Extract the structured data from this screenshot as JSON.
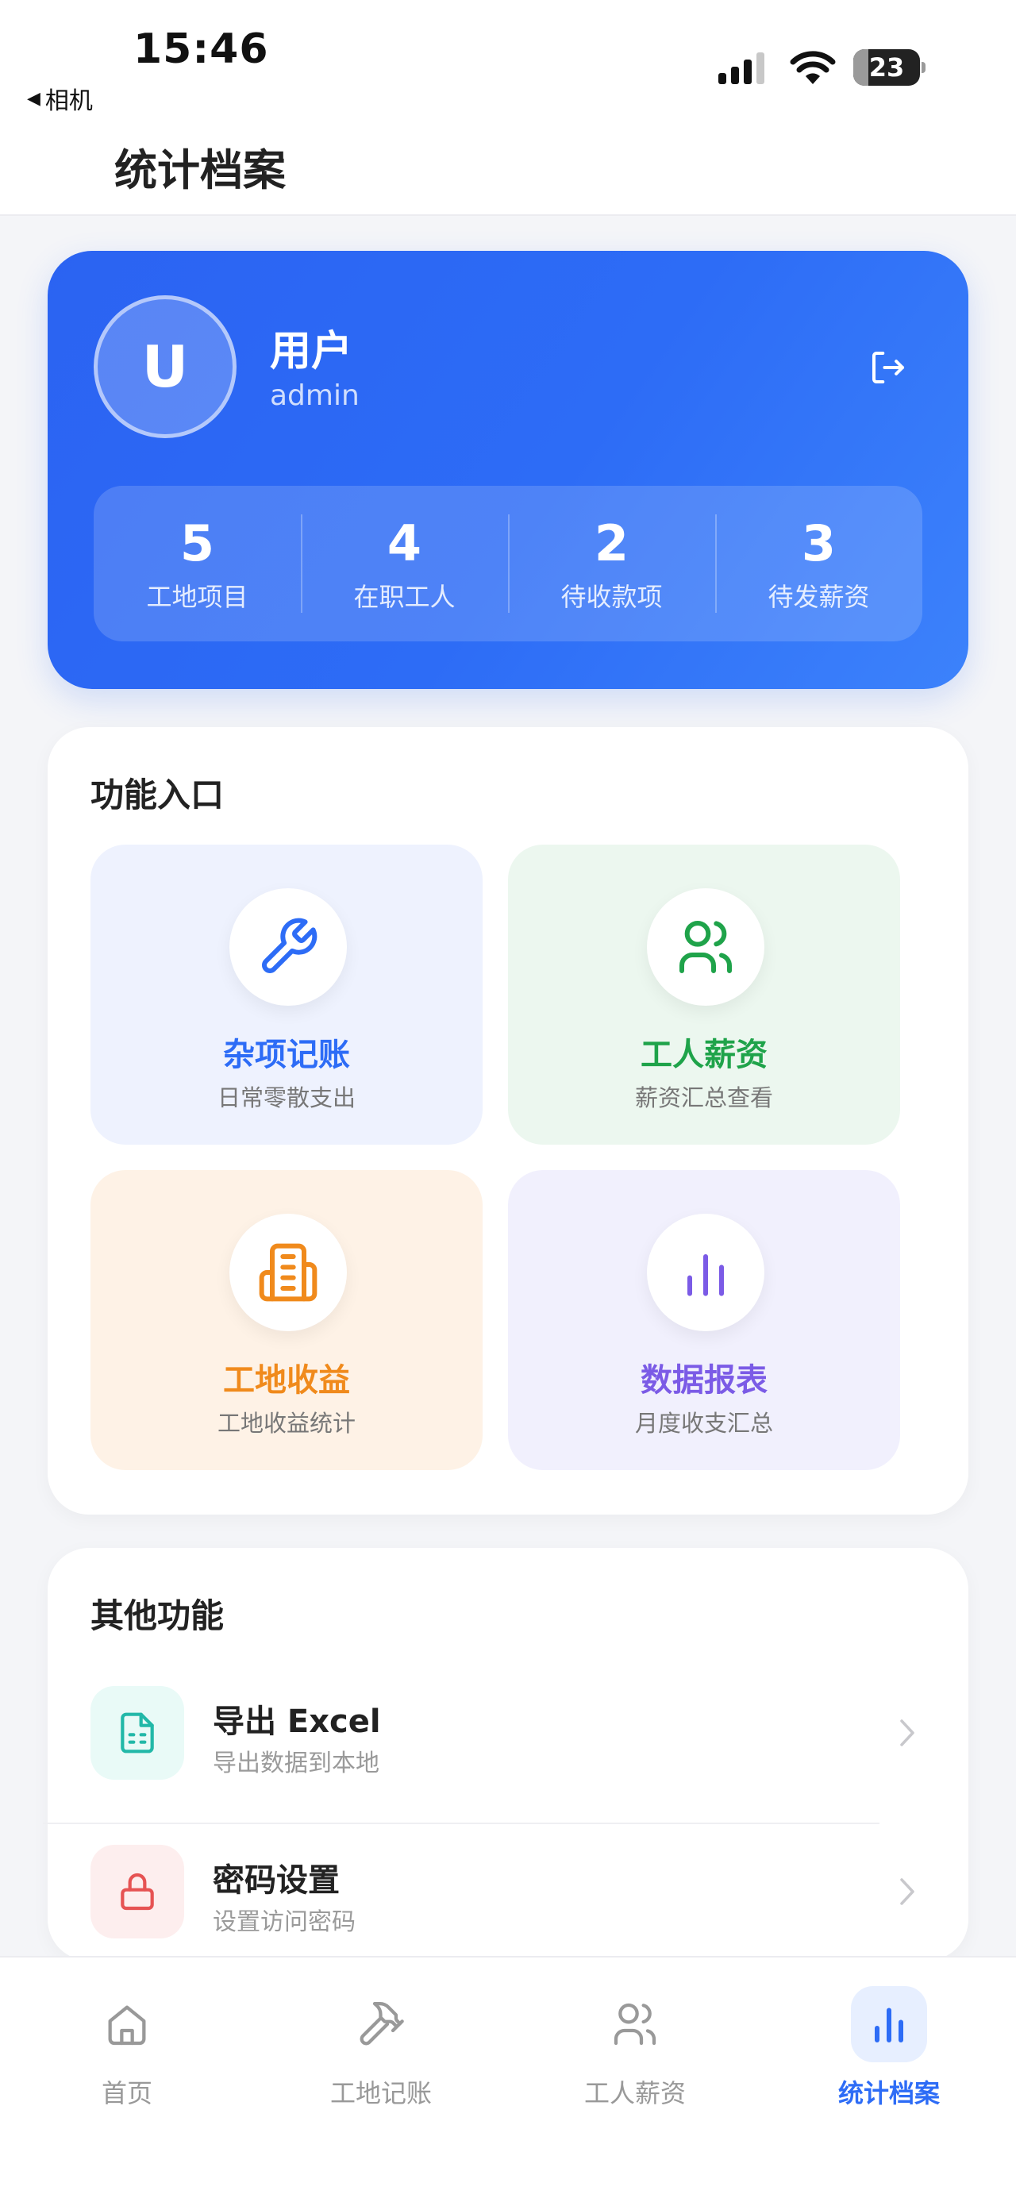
{
  "status_bar": {
    "time": "15:46",
    "back_label": "相机",
    "battery_level": "23",
    "battery_fraction": 0.23
  },
  "header": {
    "title": "统计档案"
  },
  "profile": {
    "avatar_letter": "U",
    "name": "用户",
    "username": "admin",
    "stats": [
      {
        "value": "5",
        "label": "工地项目"
      },
      {
        "value": "4",
        "label": "在职工人"
      },
      {
        "value": "2",
        "label": "待收款项"
      },
      {
        "value": "3",
        "label": "待发薪资"
      }
    ]
  },
  "functions": {
    "title": "功能入口",
    "tiles": [
      {
        "title": "杂项记账",
        "subtitle": "日常零散支出",
        "icon": "wrench-icon",
        "color": "#2d6cf6",
        "bg": "#eef2fe"
      },
      {
        "title": "工人薪资",
        "subtitle": "薪资汇总查看",
        "icon": "users-icon",
        "color": "#1fa34a",
        "bg": "#ecf7ef"
      },
      {
        "title": "工地收益",
        "subtitle": "工地收益统计",
        "icon": "building-icon",
        "color": "#f08a1c",
        "bg": "#fef2e6"
      },
      {
        "title": "数据报表",
        "subtitle": "月度收支汇总",
        "icon": "bar-chart-icon",
        "color": "#7b5be6",
        "bg": "#f1f0fd"
      }
    ]
  },
  "other": {
    "title": "其他功能",
    "items": [
      {
        "title": "导出 Excel",
        "subtitle": "导出数据到本地",
        "icon": "file-icon",
        "color": "#22b8a8",
        "bg": "#e9faf7"
      },
      {
        "title": "密码设置",
        "subtitle": "设置访问密码",
        "icon": "lock-icon",
        "color": "#e65353",
        "bg": "#fdeeee"
      }
    ]
  },
  "tabbar": {
    "tabs": [
      {
        "label": "首页",
        "icon": "home-icon",
        "active": false
      },
      {
        "label": "工地记账",
        "icon": "hammer-icon",
        "active": false
      },
      {
        "label": "工人薪资",
        "icon": "users-icon",
        "active": false
      },
      {
        "label": "统计档案",
        "icon": "bar-chart-icon",
        "active": true
      }
    ],
    "active_color": "#2d6cf6",
    "inactive_color": "#999999"
  }
}
